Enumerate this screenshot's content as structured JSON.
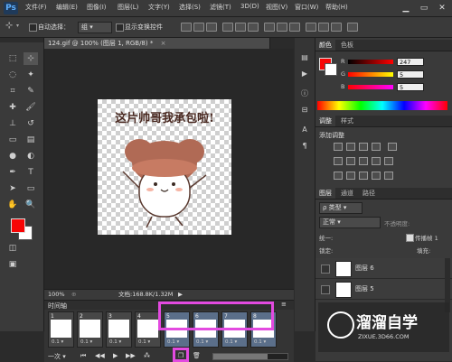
{
  "app": {
    "logo": "Ps"
  },
  "menu": [
    "文件(F)",
    "编辑(E)",
    "图像(I)",
    "图层(L)",
    "文字(Y)",
    "选择(S)",
    "滤镜(T)",
    "3D(D)",
    "视图(V)",
    "窗口(W)",
    "帮助(H)"
  ],
  "window_controls": {
    "minimize": "▁",
    "restore": "▭",
    "close": "✕"
  },
  "options": {
    "auto_select_label": "自动选择：",
    "auto_select_value": "组",
    "show_transform_label": "显示变换控件"
  },
  "document": {
    "tab_title": "124.gif @ 100% (图层 1, RGB/8) *",
    "close": "×",
    "canvas_text": "这片帅哥我承包啦!"
  },
  "status": {
    "zoom": "100%",
    "doc_info": "文档:168.8K/1.32M"
  },
  "timeline": {
    "title": "时间轴",
    "frames": [
      {
        "num": "1",
        "delay": "0.1 ▾",
        "selected": false
      },
      {
        "num": "2",
        "delay": "0.1 ▾",
        "selected": false
      },
      {
        "num": "3",
        "delay": "0.1 ▾",
        "selected": false
      },
      {
        "num": "4",
        "delay": "0.1 ▾",
        "selected": false
      },
      {
        "num": "5",
        "delay": "0.1 ▾",
        "selected": true
      },
      {
        "num": "6",
        "delay": "0.1 ▾",
        "selected": true
      },
      {
        "num": "7",
        "delay": "0.1 ▾",
        "selected": true
      },
      {
        "num": "8",
        "delay": "0.1 ▾",
        "selected": true
      }
    ],
    "loop_option": "一次 ▾"
  },
  "color_panel": {
    "tabs": [
      "颜色",
      "色板"
    ],
    "channels": [
      {
        "label": "R",
        "value": "247"
      },
      {
        "label": "G",
        "value": "5"
      },
      {
        "label": "B",
        "value": "5"
      }
    ],
    "foreground_color": "#f70505"
  },
  "adjust_panel": {
    "tabs": [
      "调整",
      "样式"
    ],
    "title": "添加调整"
  },
  "layers_panel": {
    "tabs": [
      "图层",
      "通道",
      "路径"
    ],
    "kind_filter": "ρ 类型",
    "blend_mode": "正常",
    "opacity_label": "不透明度:",
    "unify_label": "统一:",
    "propagate_label": "传播帧 1",
    "lock_label": "锁定:",
    "fill_label": "填充:",
    "layers": [
      {
        "name": "图层 6"
      },
      {
        "name": "图层 5"
      }
    ]
  },
  "watermark": {
    "title": "溜溜自学",
    "subtitle": "ZIXUE.3D66.COM"
  },
  "colors": {
    "highlight": "#e34ae0",
    "foreground": "#f70505",
    "background": "#ffffff"
  }
}
